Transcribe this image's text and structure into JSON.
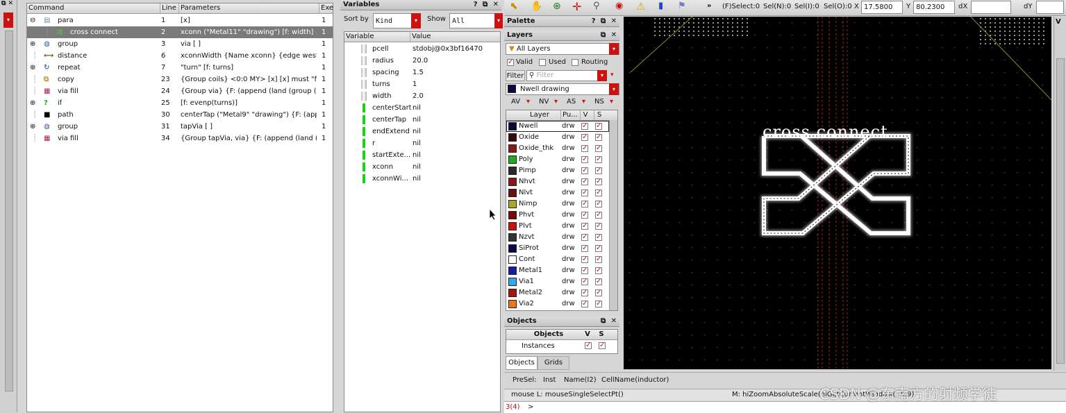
{
  "command_panel": {
    "headers": {
      "command": "Command",
      "line": "Line",
      "parameters": "Parameters",
      "exe": "Exe"
    },
    "rows": [
      {
        "name": "para",
        "line": "1",
        "params": "[x]",
        "exe": "1",
        "icon": "param-icon",
        "expander": "⊖",
        "indent": 0
      },
      {
        "name": "cross connect",
        "line": "2",
        "params": "xconn (\"Metal11\" \"drawing\") [f: width] ...",
        "exe": "1",
        "icon": "path-connect-icon",
        "expander": "",
        "indent": 1
      },
      {
        "name": "group",
        "line": "3",
        "params": "via [ ]",
        "exe": "1",
        "icon": "globe-icon",
        "expander": "⊕",
        "indent": 0
      },
      {
        "name": "distance",
        "line": "6",
        "params": "xconnWidth {Name xconn} {edge west...",
        "exe": "1",
        "icon": "ruler-icon",
        "expander": "",
        "indent": 0
      },
      {
        "name": "repeat",
        "line": "7",
        "params": "\"turn\" [f: turns]",
        "exe": "1",
        "icon": "repeat-icon",
        "expander": "⊕",
        "indent": 0
      },
      {
        "name": "copy",
        "line": "23",
        "params": "{Group coils} <0:0 MY> [x] [x] must \"fr...",
        "exe": "1",
        "icon": "copy-icon",
        "expander": "",
        "indent": 0
      },
      {
        "name": "via fill",
        "line": "24",
        "params": "{Group via} {F: (append (land (group (\"...",
        "exe": "1",
        "icon": "via-icon",
        "expander": "",
        "indent": 0
      },
      {
        "name": "if",
        "line": "25",
        "params": "[f: evenp(turns)]",
        "exe": "1",
        "icon": "question-icon",
        "expander": "⊕",
        "indent": 0
      },
      {
        "name": "path",
        "line": "30",
        "params": "centerTap (\"Metal9\" \"drawing\") {F: (app...",
        "exe": "1",
        "icon": "path-icon",
        "expander": "",
        "indent": 0
      },
      {
        "name": "group",
        "line": "31",
        "params": "tapVia [ ]",
        "exe": "1",
        "icon": "globe-icon",
        "expander": "⊕",
        "indent": 0
      },
      {
        "name": "via fill",
        "line": "34",
        "params": "{Group tapVia, via} {F: (append (land (...",
        "exe": "1",
        "icon": "via-icon",
        "expander": "",
        "indent": 0
      }
    ]
  },
  "variables_panel": {
    "title": "Variables",
    "sort_label": "Sort by",
    "sort_value": "Kind",
    "show_label": "Show",
    "show_value": "All",
    "headers": {
      "variable": "Variable",
      "value": "Value"
    },
    "rows": [
      {
        "name": "pcell",
        "value": "stdobj@0x3bf16470",
        "kind": "gray"
      },
      {
        "name": "radius",
        "value": "20.0",
        "kind": "gray"
      },
      {
        "name": "spacing",
        "value": "1.5",
        "kind": "gray"
      },
      {
        "name": "turns",
        "value": "1",
        "kind": "gray"
      },
      {
        "name": "width",
        "value": "2.0",
        "kind": "gray"
      },
      {
        "name": "centerStart",
        "value": "nil",
        "kind": "green"
      },
      {
        "name": "centerTap",
        "value": "nil",
        "kind": "green"
      },
      {
        "name": "endExtend",
        "value": "nil",
        "kind": "green"
      },
      {
        "name": "r",
        "value": "nil",
        "kind": "green"
      },
      {
        "name": "startExte...",
        "value": "nil",
        "kind": "green"
      },
      {
        "name": "xconn",
        "value": "nil",
        "kind": "green"
      },
      {
        "name": "xconnWi...",
        "value": "nil",
        "kind": "green"
      }
    ]
  },
  "toolbar": {
    "fselect": "(F)Select:0",
    "seln": "Sel(N):0",
    "seli": "Sel(I):0",
    "selo": "Sel(O):0",
    "x_label": "X",
    "x_value": "17.5800",
    "y_label": "Y",
    "y_value": "80.2300",
    "dx_label": "dX",
    "dx_value": "",
    "dy_label": "dY",
    "dy_value": "",
    "more": "»"
  },
  "palette": {
    "title": "Palette"
  },
  "layers_panel": {
    "title": "Layers",
    "filter_combo": "All Layers",
    "valid_label": "Valid",
    "used_label": "Used",
    "routing_label": "Routing",
    "filter_btn": "Filter",
    "filter_placeholder": "Filter",
    "current_layer": "Nwell drawing",
    "vis_buttons": [
      "AV",
      "NV",
      "AS",
      "NS"
    ],
    "headers": {
      "layer": "Layer",
      "purpose": "Pu...",
      "v": "V",
      "s": "S"
    },
    "rows": [
      {
        "name": "Nwell",
        "purpose": "drw",
        "color": "#0a0a3a"
      },
      {
        "name": "Oxide",
        "purpose": "drw",
        "color": "#3a0a0a"
      },
      {
        "name": "Oxide_thk",
        "purpose": "drw",
        "color": "#8a1a1a"
      },
      {
        "name": "Poly",
        "purpose": "drw",
        "color": "#22aa22"
      },
      {
        "name": "Pimp",
        "purpose": "drw",
        "color": "#2a2a2a"
      },
      {
        "name": "Nhvt",
        "purpose": "drw",
        "color": "#8a1a1a"
      },
      {
        "name": "Nlvt",
        "purpose": "drw",
        "color": "#6a1010"
      },
      {
        "name": "Nimp",
        "purpose": "drw",
        "color": "#aaaa22"
      },
      {
        "name": "Phvt",
        "purpose": "drw",
        "color": "#7a0a0a"
      },
      {
        "name": "Plvt",
        "purpose": "drw",
        "color": "#cc1111"
      },
      {
        "name": "Nzvt",
        "purpose": "drw",
        "color": "#333333"
      },
      {
        "name": "SiProt",
        "purpose": "drw",
        "color": "#0a0a4a"
      },
      {
        "name": "Cont",
        "purpose": "drw",
        "color": "#ffffff"
      },
      {
        "name": "Metal1",
        "purpose": "drw",
        "color": "#1a1aaa"
      },
      {
        "name": "Via1",
        "purpose": "drw",
        "color": "#33aaee"
      },
      {
        "name": "Metal2",
        "purpose": "drw",
        "color": "#aa1111"
      },
      {
        "name": "Via2",
        "purpose": "drw",
        "color": "#ee7711"
      }
    ]
  },
  "objects_panel": {
    "title": "Objects",
    "headers": {
      "objects": "Objects",
      "v": "V",
      "s": "S"
    },
    "rows": [
      {
        "name": "Instances"
      }
    ],
    "tabs": [
      "Objects",
      "Grids"
    ]
  },
  "canvas": {
    "label": "cross connect"
  },
  "status": {
    "presel": "PreSel:",
    "inst": "Inst",
    "name": "Name(I2)",
    "cellname": "CellName(inductor)",
    "mouse_l": "mouse L: mouseSingleSelectPt()",
    "mouse_m": "M: hiZoomAbsoluteScale(hiGetCurrentWindow() 0.9)",
    "prompt_num": "3(4)",
    "prompt": ">",
    "watermark": "CSDN @东南方的射频学徒"
  }
}
